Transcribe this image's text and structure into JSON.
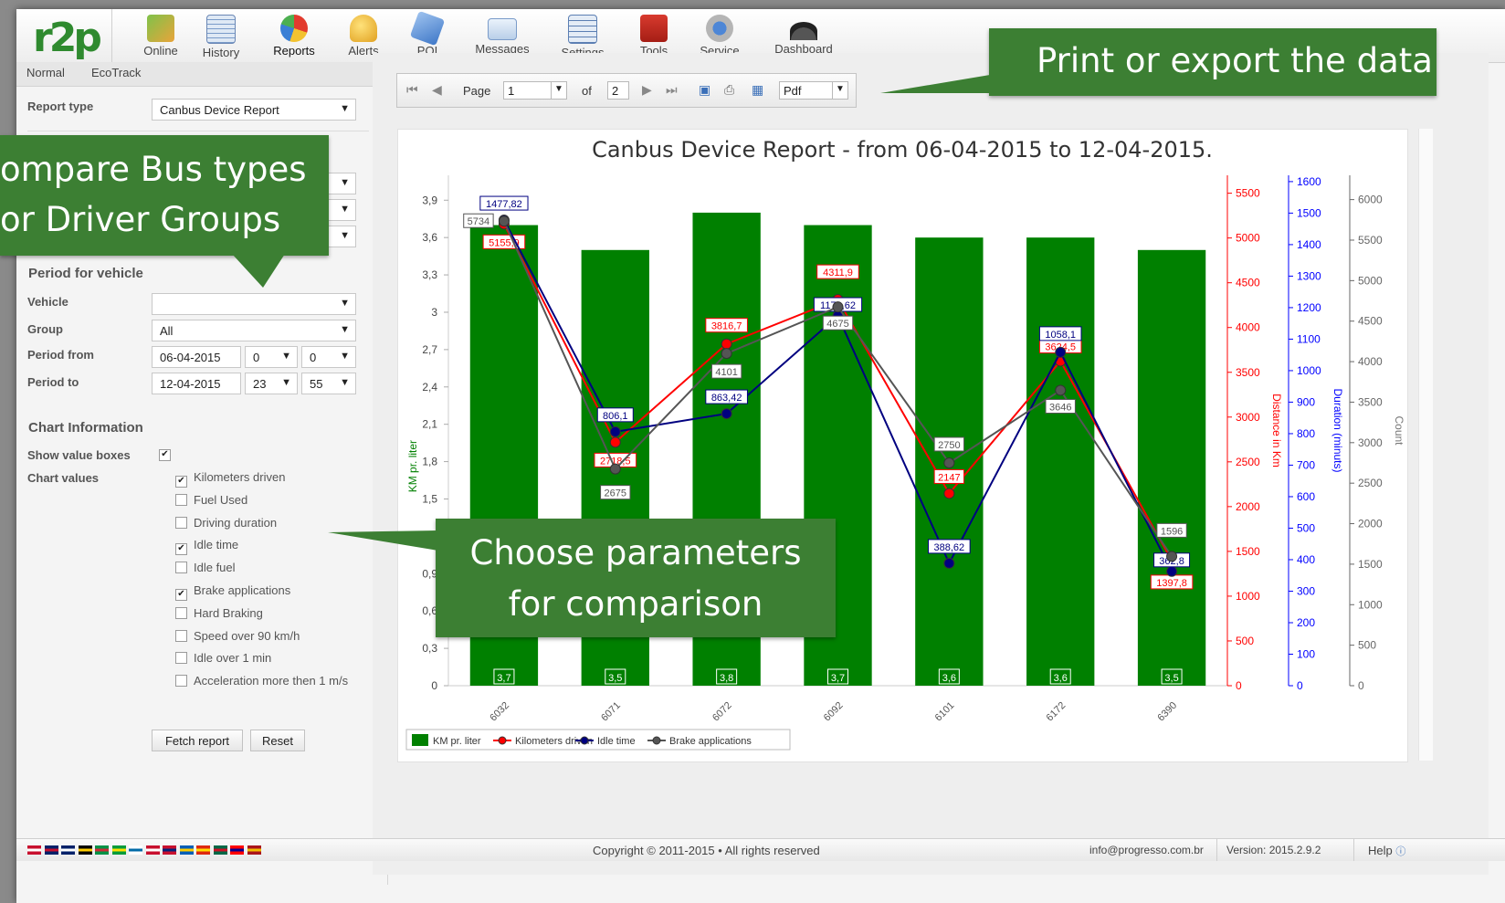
{
  "topbar": {
    "logo": "r2p",
    "items": [
      {
        "label": "Online",
        "icon": "online-icon"
      },
      {
        "label": "History",
        "icon": "history-icon"
      },
      {
        "label": "Reports",
        "icon": "reports-icon"
      },
      {
        "label": "Alerts",
        "icon": "alerts-bell-icon"
      },
      {
        "label": "POI",
        "icon": "poi-icon"
      },
      {
        "label": "Messages",
        "icon": "messages-icon"
      },
      {
        "label": "Settings",
        "icon": "settings-icon"
      },
      {
        "label": "Tools",
        "icon": "tools-icon"
      },
      {
        "label": "Service",
        "icon": "service-icon"
      },
      {
        "label": "Dashboard",
        "icon": "dashboard-icon"
      }
    ],
    "active": "Reports"
  },
  "tabs": [
    "Normal",
    "EcoTrack"
  ],
  "form": {
    "report_type_label": "Report type",
    "report_type_value": "Canbus Device Report",
    "period_section": "Period for vehicle",
    "vehicle_label": "Vehicle",
    "vehicle_value": "",
    "group_label": "Group",
    "group_value": "All",
    "period_from_label": "Period from",
    "period_from_date": "06-04-2015",
    "period_from_hour": "0",
    "period_from_min": "0",
    "period_to_label": "Period to",
    "period_to_date": "12-04-2015",
    "period_to_hour": "23",
    "period_to_min": "55",
    "chart_info_section": "Chart Information",
    "show_value_boxes_label": "Show value boxes",
    "chart_values_label": "Chart values",
    "chart_values": [
      {
        "label": "Kilometers driven",
        "checked": true
      },
      {
        "label": "Fuel Used",
        "checked": false
      },
      {
        "label": "Driving duration",
        "checked": false
      },
      {
        "label": "Idle time",
        "checked": true
      },
      {
        "label": "Idle fuel",
        "checked": false
      },
      {
        "label": "Brake applications",
        "checked": true
      },
      {
        "label": "Hard Braking",
        "checked": false
      },
      {
        "label": "Speed over 90 km/h",
        "checked": false
      },
      {
        "label": "Idle over 1 min",
        "checked": false
      },
      {
        "label": "Acceleration more then 1 m/s",
        "checked": false
      }
    ],
    "fetch_button": "Fetch report",
    "reset_button": "Reset"
  },
  "navbar": {
    "page_label": "Page",
    "page_value": "1",
    "of_label": "of",
    "total_pages": "2",
    "format_value": "Pdf"
  },
  "callouts": {
    "export": "Print or export the data",
    "compare_line1": "ompare Bus types",
    "compare_line2": "or Driver Groups",
    "params_line1": "Choose parameters",
    "params_line2": "for comparison"
  },
  "footer": {
    "copyright": "Copyright © 2011-2015 • All rights reserved",
    "email": "info@progresso.com.br",
    "version": "Version: 2015.2.9.2",
    "help": "Help"
  },
  "chart_data": {
    "type": "bar",
    "title": "Canbus Device Report - from 06-04-2015 to 12-04-2015.",
    "categories": [
      "6032",
      "6071",
      "6072",
      "6092",
      "6101",
      "6172",
      "6390"
    ],
    "bar_series": {
      "name": "KM pr. liter",
      "values": [
        3.7,
        3.5,
        3.8,
        3.7,
        3.6,
        3.6,
        3.5
      ],
      "labels": [
        "3,7",
        "3,5",
        "3,8",
        "3,7",
        "3,6",
        "3,6",
        "3,5"
      ],
      "color": "#008000"
    },
    "line_series": [
      {
        "name": "Kilometers driven",
        "values": [
          5155.9,
          2718.5,
          3816.7,
          4311.9,
          2147,
          3624.5,
          1397.8
        ],
        "labels": [
          "5155,9",
          "2718,5",
          "3816,7",
          "4311,9",
          "2147",
          "3624,5",
          "1397,8"
        ],
        "color": "#ff0000",
        "axis": "distance"
      },
      {
        "name": "Idle time",
        "values": [
          1477.82,
          806.1,
          863.42,
          1173.62,
          388.62,
          1058.1,
          362.8
        ],
        "labels": [
          "1477,82",
          "806,1",
          "863,42",
          "1173,62",
          "388,62",
          "1058,1",
          "362,8"
        ],
        "color": "#000080",
        "axis": "duration"
      },
      {
        "name": "Brake applications",
        "values": [
          5734,
          2675,
          4101,
          4675,
          2750,
          3646,
          1596
        ],
        "labels": [
          "5734",
          "2675",
          "4101",
          "4675",
          "2750",
          "3646",
          "1596"
        ],
        "color": "#555555",
        "axis": "count"
      }
    ],
    "axes": {
      "left": {
        "label": "KM pr. liter",
        "min": 0,
        "max": 4.1,
        "ticks": [
          "0",
          "0,3",
          "0,6",
          "0,9",
          "1,2",
          "1,5",
          "1,8",
          "2,1",
          "2,4",
          "2,7",
          "3",
          "3,3",
          "3,6",
          "3,9"
        ],
        "color": "#008000"
      },
      "distance": {
        "label": "Distance in Km",
        "min": 0,
        "max": 5700,
        "ticks": [
          0,
          500,
          1000,
          1500,
          2000,
          2500,
          3000,
          3500,
          4000,
          4500,
          5000,
          5500
        ],
        "color": "#ff0000"
      },
      "duration": {
        "label": "Duration (minuts)",
        "min": 0,
        "max": 1620,
        "ticks": [
          0,
          100,
          200,
          300,
          400,
          500,
          600,
          700,
          800,
          900,
          1000,
          1100,
          1200,
          1300,
          1400,
          1500,
          1600
        ],
        "color": "#0000ff"
      },
      "count": {
        "label": "Count",
        "min": 0,
        "max": 6300,
        "ticks": [
          0,
          500,
          1000,
          1500,
          2000,
          2500,
          3000,
          3500,
          4000,
          4500,
          5000,
          5500,
          6000
        ],
        "color": "#666666"
      }
    },
    "legend": [
      "KM pr. liter",
      "Kilometers driven",
      "Idle time",
      "Brake applications"
    ],
    "legend_position": "bottom-left",
    "grid": false
  }
}
